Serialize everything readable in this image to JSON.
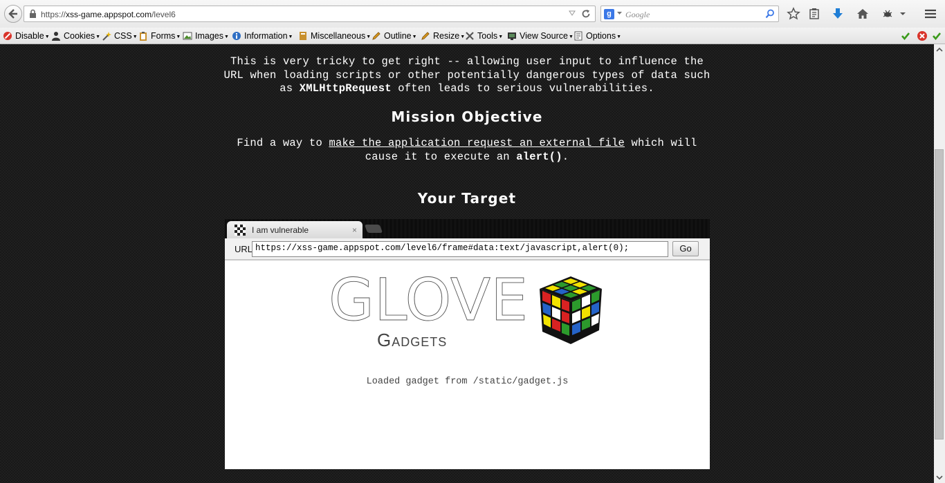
{
  "browser": {
    "url_prefix": "https://",
    "url_host": "xss-game.appspot.com",
    "url_path": "/level6",
    "search_placeholder": "Google"
  },
  "dev_toolbar": {
    "items": [
      {
        "label": "Disable",
        "icon": "disable-icon"
      },
      {
        "label": "Cookies",
        "icon": "cookie-icon"
      },
      {
        "label": "CSS",
        "icon": "wand-icon"
      },
      {
        "label": "Forms",
        "icon": "clipboard-icon"
      },
      {
        "label": "Images",
        "icon": "image-icon"
      },
      {
        "label": "Information",
        "icon": "info-icon"
      },
      {
        "label": "Miscellaneous",
        "icon": "book-icon"
      },
      {
        "label": "Outline",
        "icon": "pencil-icon"
      },
      {
        "label": "Resize",
        "icon": "pencil-icon"
      },
      {
        "label": "Tools",
        "icon": "tools-icon"
      },
      {
        "label": "View Source",
        "icon": "monitor-icon"
      },
      {
        "label": "Options",
        "icon": "options-icon"
      }
    ]
  },
  "page": {
    "intro": {
      "line1": "This is very tricky to get right -- allowing user input to influence the",
      "line2": "URL when loading scripts or other potentially dangerous types of data such",
      "line3_pre": "as ",
      "line3_code": "XMLHttpRequest",
      "line3_post": " often leads to serious vulnerabilities."
    },
    "objective_heading": "Mission Objective",
    "objective": {
      "pre": "Find a way to ",
      "link": "make the application request an external file",
      "post": " which will",
      "line2_pre": "cause it to execute an ",
      "line2_code": "alert()",
      "line2_post": "."
    },
    "target_heading": "Your Target"
  },
  "target_frame": {
    "tab_title": "I am vulnerable",
    "tab_close": "×",
    "url_label": "URL",
    "url_value": "https://xss-game.appspot.com/level6/frame#data:text/javascript,alert(0);",
    "go_label": "Go",
    "logo_word": "GLOVE",
    "logo_sub": "Gadgets",
    "loaded_message": "Loaded gadget from /static/gadget.js"
  }
}
